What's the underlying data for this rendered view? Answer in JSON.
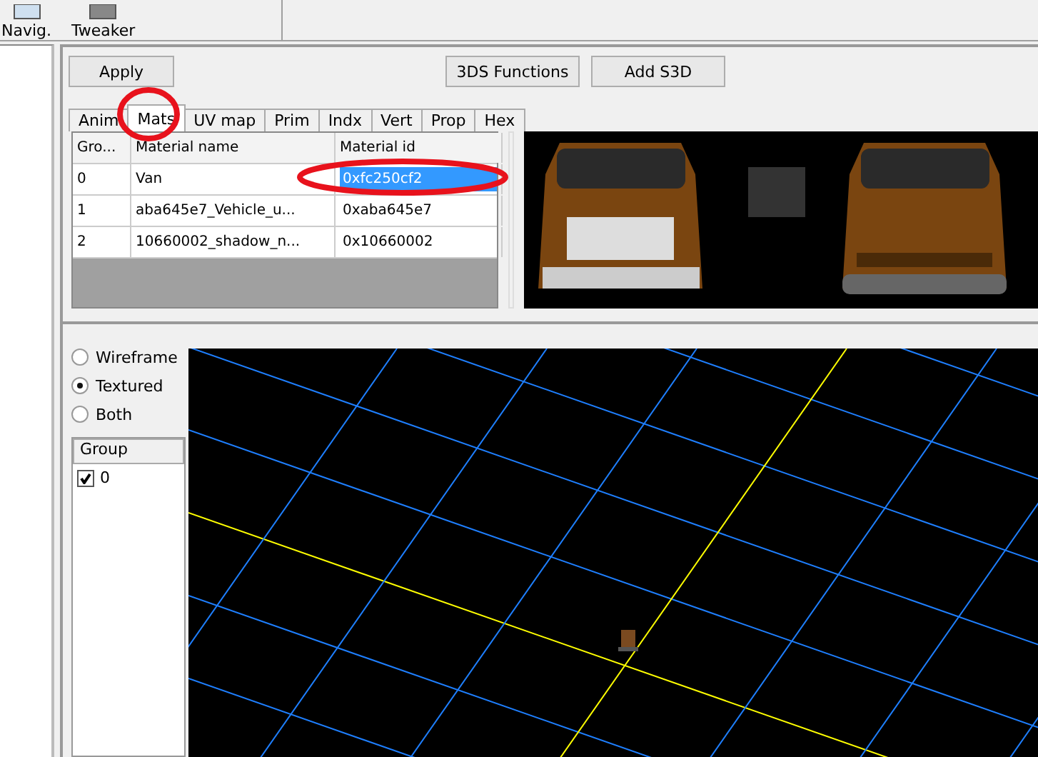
{
  "toolbar": {
    "items": [
      {
        "label": "Navig."
      },
      {
        "label": "Tweaker"
      }
    ]
  },
  "buttons": [
    "Apply",
    "3DS Functions",
    "Add S3D"
  ],
  "tabs": [
    {
      "label": "Anim",
      "selected": false
    },
    {
      "label": "Mats",
      "selected": true
    },
    {
      "label": "UV map",
      "selected": false
    },
    {
      "label": "Prim",
      "selected": false
    },
    {
      "label": "Indx",
      "selected": false
    },
    {
      "label": "Vert",
      "selected": false
    },
    {
      "label": "Prop",
      "selected": false
    },
    {
      "label": "Hex",
      "selected": false
    }
  ],
  "table": {
    "columns": [
      "Gro...",
      "Material name",
      "Material id"
    ],
    "rows": [
      {
        "cells": [
          "0",
          "Van",
          "0xfc250cf2"
        ],
        "selected": true
      },
      {
        "cells": [
          "1",
          "aba645e7_Vehicle_u...",
          "0xaba645e7"
        ],
        "selected": false
      },
      {
        "cells": [
          "2",
          "10660002_shadow_n...",
          "0x10660002"
        ],
        "selected": false
      }
    ]
  },
  "render_modes": [
    {
      "label": "Wireframe",
      "selected": false
    },
    {
      "label": "Textured",
      "selected": true
    },
    {
      "label": "Both",
      "selected": false
    }
  ],
  "groups": {
    "header": "Group",
    "items": [
      {
        "label": "0",
        "checked": true
      }
    ]
  }
}
